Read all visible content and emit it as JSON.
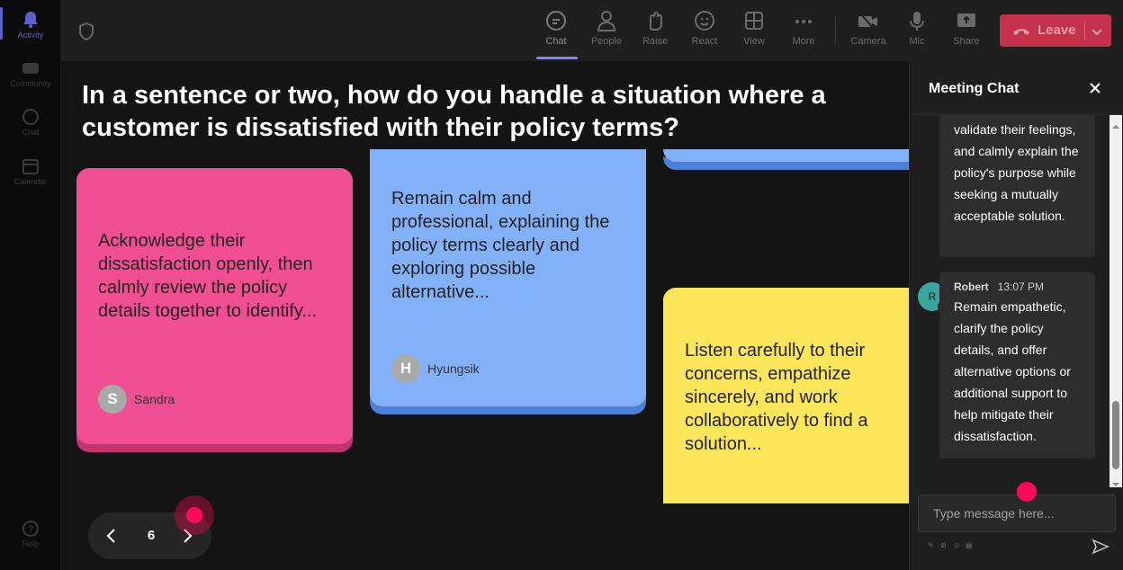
{
  "rail": {
    "items": [
      {
        "label": "Activity",
        "icon": "bell-icon",
        "active": true
      },
      {
        "label": "Community",
        "icon": "community-icon"
      },
      {
        "label": "Chat",
        "icon": "chat-icon"
      },
      {
        "label": "Calendar",
        "icon": "calendar-icon"
      },
      {
        "label": "Help",
        "icon": "help-icon"
      }
    ]
  },
  "toolbar": {
    "chat": "Chat",
    "people": "People",
    "raise": "Raise",
    "react": "React",
    "view": "View",
    "more": "More",
    "camera": "Camera",
    "mic": "Mic",
    "share": "Share",
    "leave": "Leave"
  },
  "stage": {
    "question": "In a sentence or two, how do you handle a situation where a customer is dissatisfied with their policy terms?",
    "cards": [
      {
        "text": "Acknowledge their dissatisfaction openly, then calmly review the policy details together to identify...",
        "author": "Sandra",
        "initial": "S",
        "color": "#f14f93"
      },
      {
        "text": "Remain calm and professional, explaining the policy terms clearly and exploring possible alternative...",
        "author": "Hyungsik",
        "initial": "H",
        "color": "#82b1fa"
      },
      {
        "text": "Listen carefully to their concerns, empathize sincerely, and work collaboratively to find a solution...",
        "color": "#fde65c"
      }
    ],
    "pager": {
      "page": "6"
    }
  },
  "chat": {
    "title": "Meeting Chat",
    "messages": [
      {
        "text": "validate their feelings, and calmly explain the policy's purpose while seeking a mutually acceptable solution."
      },
      {
        "author": "Robert",
        "initial": "R",
        "time": "13:07 PM",
        "text": "Remain empathetic, clarify the policy details, and offer alternative options or additional support to help mitigate their dissatisfaction."
      }
    ],
    "composer_placeholder": "Type message here..."
  },
  "colors": {
    "accent": "#5b5fc7",
    "leave": "#c4314b",
    "cursor": "#ff0a5a"
  }
}
